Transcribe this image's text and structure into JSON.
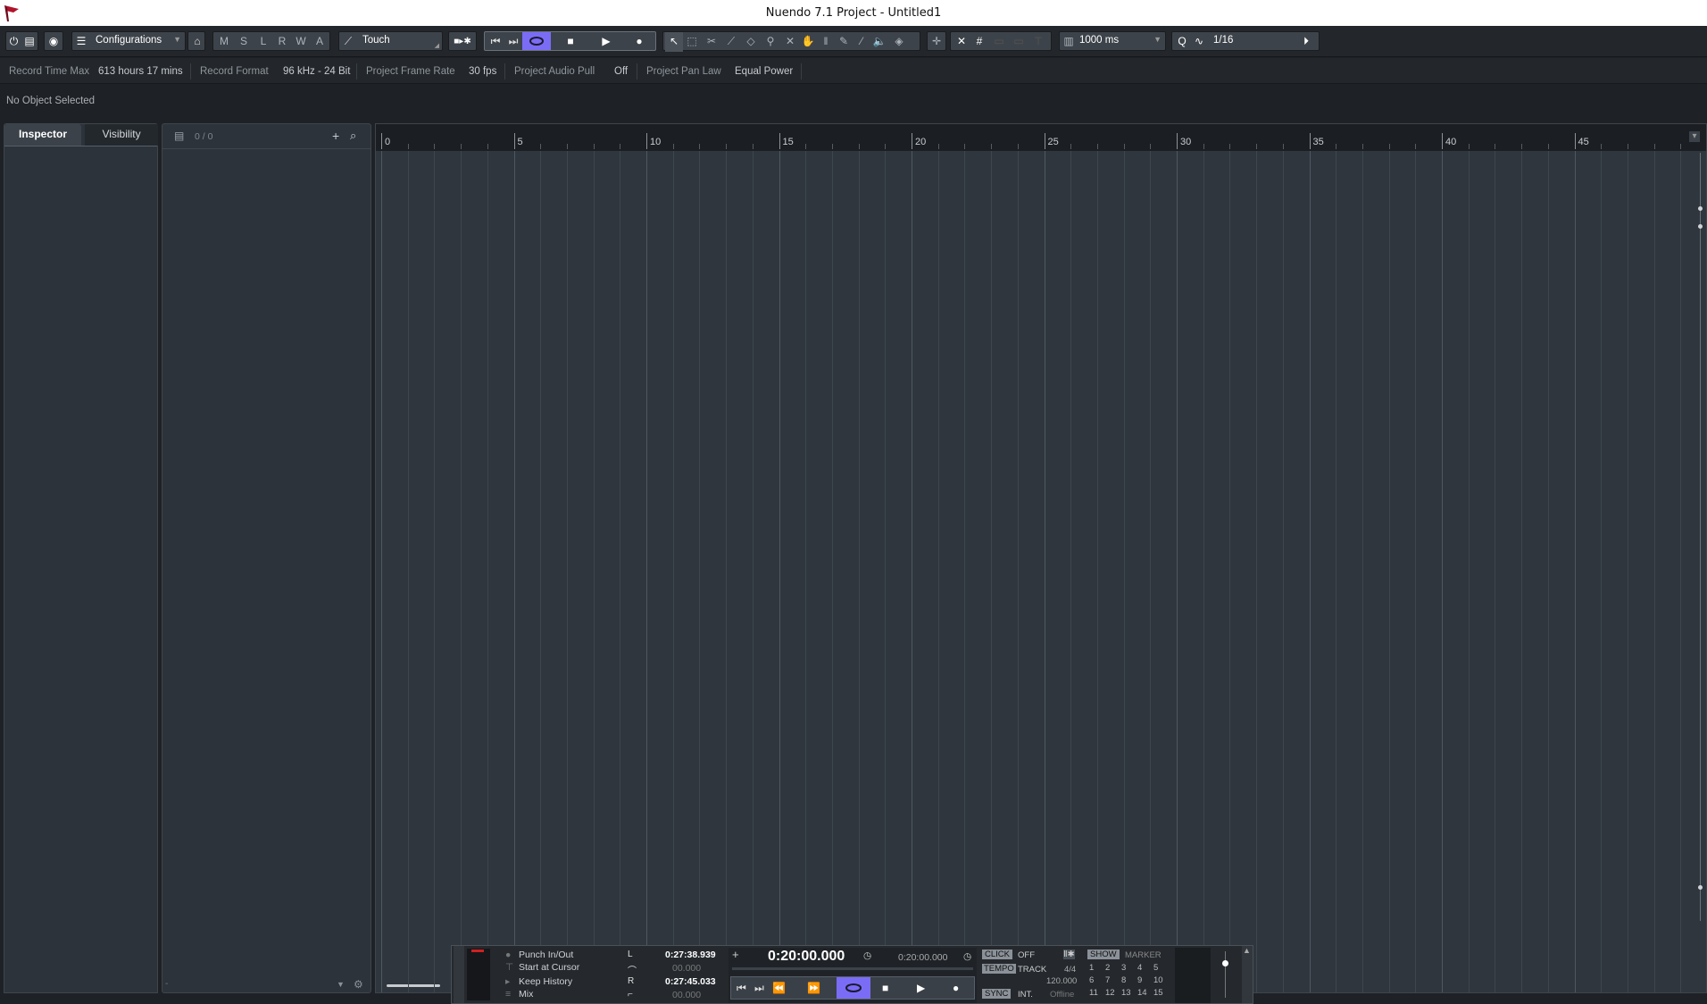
{
  "window": {
    "title": "Nuendo 7.1 Project - Untitled1"
  },
  "toolbar": {
    "configurations": "Configurations",
    "automation_buttons": [
      "M",
      "S",
      "L",
      "R",
      "W",
      "A"
    ],
    "automation_mode": "Touch",
    "nudge_value": "1000 ms",
    "quantize_value": "1/16",
    "accent_color": "#7b6cf6"
  },
  "info": {
    "record_time_max_label": "Record Time Max",
    "record_time_max_value": "613 hours 17 mins",
    "record_format_label": "Record Format",
    "record_format_value": "96 kHz - 24 Bit",
    "frame_rate_label": "Project Frame Rate",
    "frame_rate_value": "30 fps",
    "audio_pull_label": "Project Audio Pull",
    "audio_pull_value": "Off",
    "pan_law_label": "Project Pan Law",
    "pan_law_value": "Equal Power"
  },
  "object_info": "No Object Selected",
  "inspector": {
    "tabs": [
      "Inspector",
      "Visibility"
    ]
  },
  "tracklist": {
    "count": "0 / 0"
  },
  "ruler": {
    "labels": [
      "0",
      "5",
      "10",
      "15",
      "20",
      "25",
      "30",
      "35",
      "40",
      "45"
    ]
  },
  "transport": {
    "modes": [
      "Punch In/Out",
      "Start at Cursor",
      "Keep History",
      "Mix"
    ],
    "left_locator": "0:27:38.939",
    "left_sub": "00.000",
    "right_locator": "0:27:45.033",
    "right_sub": "00.000",
    "primary_time": "0:20:00.000",
    "secondary_time": "0:20:00.000",
    "click_label": "CLICK",
    "click_value": "OFF",
    "tempo_label": "TEMPO",
    "tempo_mode": "TRACK",
    "signature": "4/4",
    "tempo_value": "120.000",
    "sync_label": "SYNC",
    "sync_mode": "INT.",
    "sync_status": "Offline",
    "show_label": "SHOW",
    "marker_label": "MARKER",
    "markers": [
      "1",
      "2",
      "3",
      "4",
      "5",
      "6",
      "7",
      "8",
      "9",
      "10",
      "11",
      "12",
      "13",
      "14",
      "15"
    ]
  }
}
